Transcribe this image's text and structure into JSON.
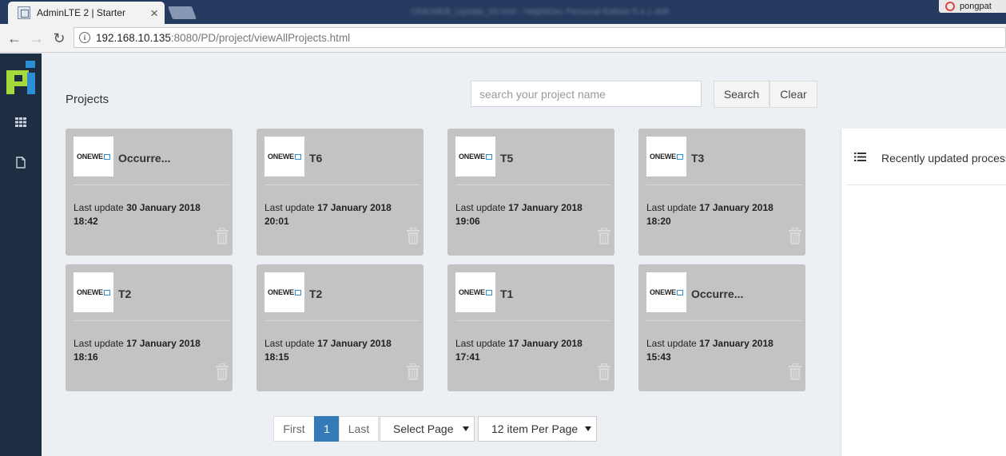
{
  "browser": {
    "tab_title": "AdminLTE 2 | Starter",
    "tab_close": "×",
    "window_title": "ONEWEB_Update_05.tmd - HelpNDoc Personal Edition 5.4.1.406",
    "user_name": "pongpat",
    "url_host": "192.168.10.135",
    "url_path": ":8080/PD/project/viewAllProjects.html",
    "info_glyph": "i",
    "back_glyph": "←",
    "forward_glyph": "→",
    "reload_glyph": "↻"
  },
  "header": {
    "title": "Projects",
    "search_placeholder": "search your project name",
    "search_label": "Search",
    "clear_label": "Clear"
  },
  "projects": [
    {
      "name": "Occurre...",
      "update_prefix": "Last update",
      "date": "30 January 2018",
      "time": "18:42"
    },
    {
      "name": "T6",
      "update_prefix": "Last update",
      "date": "17 January 2018",
      "time": "20:01"
    },
    {
      "name": "T5",
      "update_prefix": "Last update",
      "date": "17 January 2018",
      "time": "19:06"
    },
    {
      "name": "T3",
      "update_prefix": "Last update",
      "date": "17 January 2018",
      "time": "18:20"
    },
    {
      "name": "T2",
      "update_prefix": "Last update",
      "date": "17 January 2018",
      "time": "18:16"
    },
    {
      "name": "T2",
      "update_prefix": "Last update",
      "date": "17 January 2018",
      "time": "18:15"
    },
    {
      "name": "T1",
      "update_prefix": "Last update",
      "date": "17 January 2018",
      "time": "17:41"
    },
    {
      "name": "Occurre...",
      "update_prefix": "Last update",
      "date": "17 January 2018",
      "time": "15:43"
    }
  ],
  "card_logo_text": "ONEWE",
  "pagination": {
    "first": "First",
    "current": "1",
    "last": "Last",
    "select_page": "Select Page",
    "per_page": "12 item Per Page"
  },
  "recent": {
    "title": "Recently updated process"
  },
  "colors": {
    "sidebar": "#1f2d43",
    "card": "#c3c3c3",
    "active_page": "#337ab7",
    "logo_blue": "#2a8fd6",
    "logo_green": "#a6d93b"
  }
}
